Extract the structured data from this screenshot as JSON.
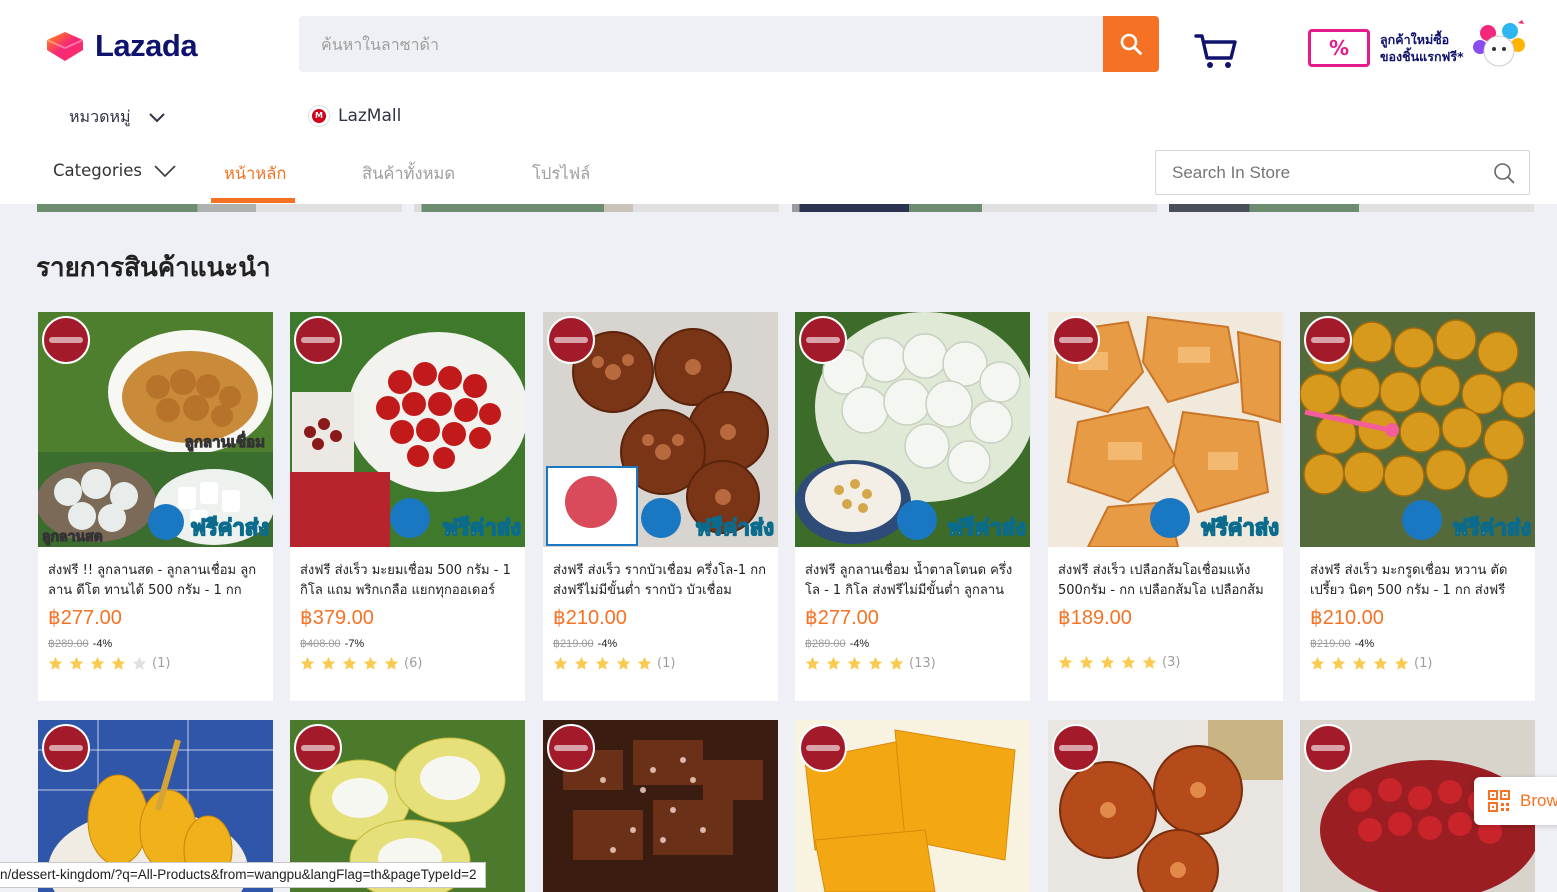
{
  "header": {
    "logo_text": "Lazada",
    "search_placeholder": "ค้นหาในลาซาด้า",
    "promo_line1": "ลูกค้าใหม่ซื้อ",
    "promo_line2": "ของชิ้นแรกฟรี*",
    "promo_tag": "%"
  },
  "subnav": {
    "categories_label": "หมวดหมู่",
    "lazmall_label": "LazMall",
    "lazmall_badge": "M"
  },
  "store_nav": {
    "categories_label": "Categories",
    "home_label": "หน้าหลัก",
    "all_products_label": "สินค้าทั้งหมด",
    "profile_label": "โปรไฟล์",
    "search_placeholder": "Search In Store"
  },
  "section": {
    "title": "รายการสินค้าแนะนำ"
  },
  "products": [
    {
      "title": "ส่งฟรี !! ลูกลานสด - ลูกลานเชื่อม ลูกลาน ดีโต ทานได้ 500 กรัม - 1 กก",
      "price": "฿277.00",
      "original": "฿289.00",
      "discount": "-4%",
      "rating": 4,
      "reviews": "(1)",
      "img_caption_1": "ลูกลานเชื่อม",
      "img_caption_2": "ลูกลานสด",
      "free_ship": "ฟรีค่าส่ง"
    },
    {
      "title": "ส่งฟรี ส่งเร็ว มะยมเชื่อม 500 กรัม - 1 กิโล แถม พริกเกลือ แยกทุกออเดอร์",
      "price": "฿379.00",
      "original": "฿408.00",
      "discount": "-7%",
      "rating": 5,
      "reviews": "(6)",
      "free_ship": "ฟรีค่าส่ง"
    },
    {
      "title": "ส่งฟรี ส่งเร็ว รากบัวเชื่อม ครึ่งโล-1 กก ส่งฟรีไม่มีขั้นต่ำ รากบัว บัวเชื่อม",
      "price": "฿210.00",
      "original": "฿219.00",
      "discount": "-4%",
      "rating": 5,
      "reviews": "(1)",
      "free_ship": "ฟรีค่าส่ง"
    },
    {
      "title": "ส่งฟรี ลูกลานเชื่อม น้ำตาลโตนด ครึ่งโล - 1 กิโล ส่งฟรีไม่มีขั้นต่ำ ลูกลาน",
      "price": "฿277.00",
      "original": "฿289.00",
      "discount": "-4%",
      "rating": 5,
      "reviews": "(13)",
      "free_ship": "ฟรีค่าส่ง"
    },
    {
      "title": "ส่งฟรี ส่งเร็ว เปลือกส้มโอเชื่อมแห้ง 500กรัม - กก เปลือกส้มโอ เปลือกส้ม",
      "price": "฿189.00",
      "original": "",
      "discount": "",
      "rating": 5,
      "reviews": "(3)",
      "free_ship": "ฟรีค่าส่ง"
    },
    {
      "title": "ส่งฟรี ส่งเร็ว มะกรูดเชื่อม หวาน ตัดเปรี้ยว นิดๆ 500 กรัม - 1 กก ส่งฟรี",
      "price": "฿210.00",
      "original": "฿219.00",
      "discount": "-4%",
      "rating": 5,
      "reviews": "(1)",
      "free_ship": "ฟรีค่าส่ง"
    }
  ],
  "browse_tab_label": "Brow",
  "status_url": "n/dessert-kingdom/?q=All-Products&from=wangpu&langFlag=th&pageTypeId=2",
  "colors": {
    "accent": "#f57224",
    "brand_navy": "#0f136d",
    "star": "#faca51"
  }
}
